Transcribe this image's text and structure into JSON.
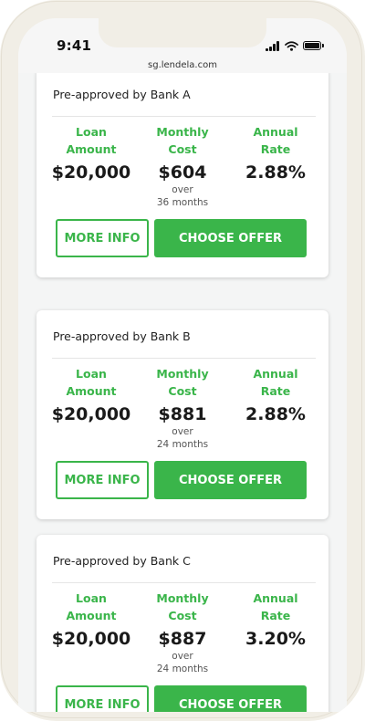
{
  "status": {
    "time": "9:41",
    "url": "sg.lendela.com"
  },
  "columns": {
    "loan_label_1": "Loan",
    "loan_label_2": "Amount",
    "monthly_label_1": "Monthly",
    "monthly_label_2": "Cost",
    "rate_label_1": "Annual",
    "rate_label_2": "Rate",
    "over": "over"
  },
  "buttons": {
    "more_info": "MORE INFO",
    "choose_offer": "CHOOSE OFFER"
  },
  "offers": [
    {
      "title": "Pre-approved by Bank A",
      "loan_amount": "$20,000",
      "monthly_cost": "$604",
      "term": "36 months",
      "annual_rate": "2.88%"
    },
    {
      "title": "Pre-approved by Bank B",
      "loan_amount": "$20,000",
      "monthly_cost": "$881",
      "term": "24 months",
      "annual_rate": "2.88%"
    },
    {
      "title": "Pre-approved by Bank C",
      "loan_amount": "$20,000",
      "monthly_cost": "$887",
      "term": "24 months",
      "annual_rate": "3.20%"
    }
  ],
  "colors": {
    "accent": "#3ab54a",
    "phone_frame": "#f1eee6",
    "background": "#f4f5f5"
  },
  "icons": [
    "signal-icon",
    "wifi-icon",
    "battery-icon"
  ]
}
